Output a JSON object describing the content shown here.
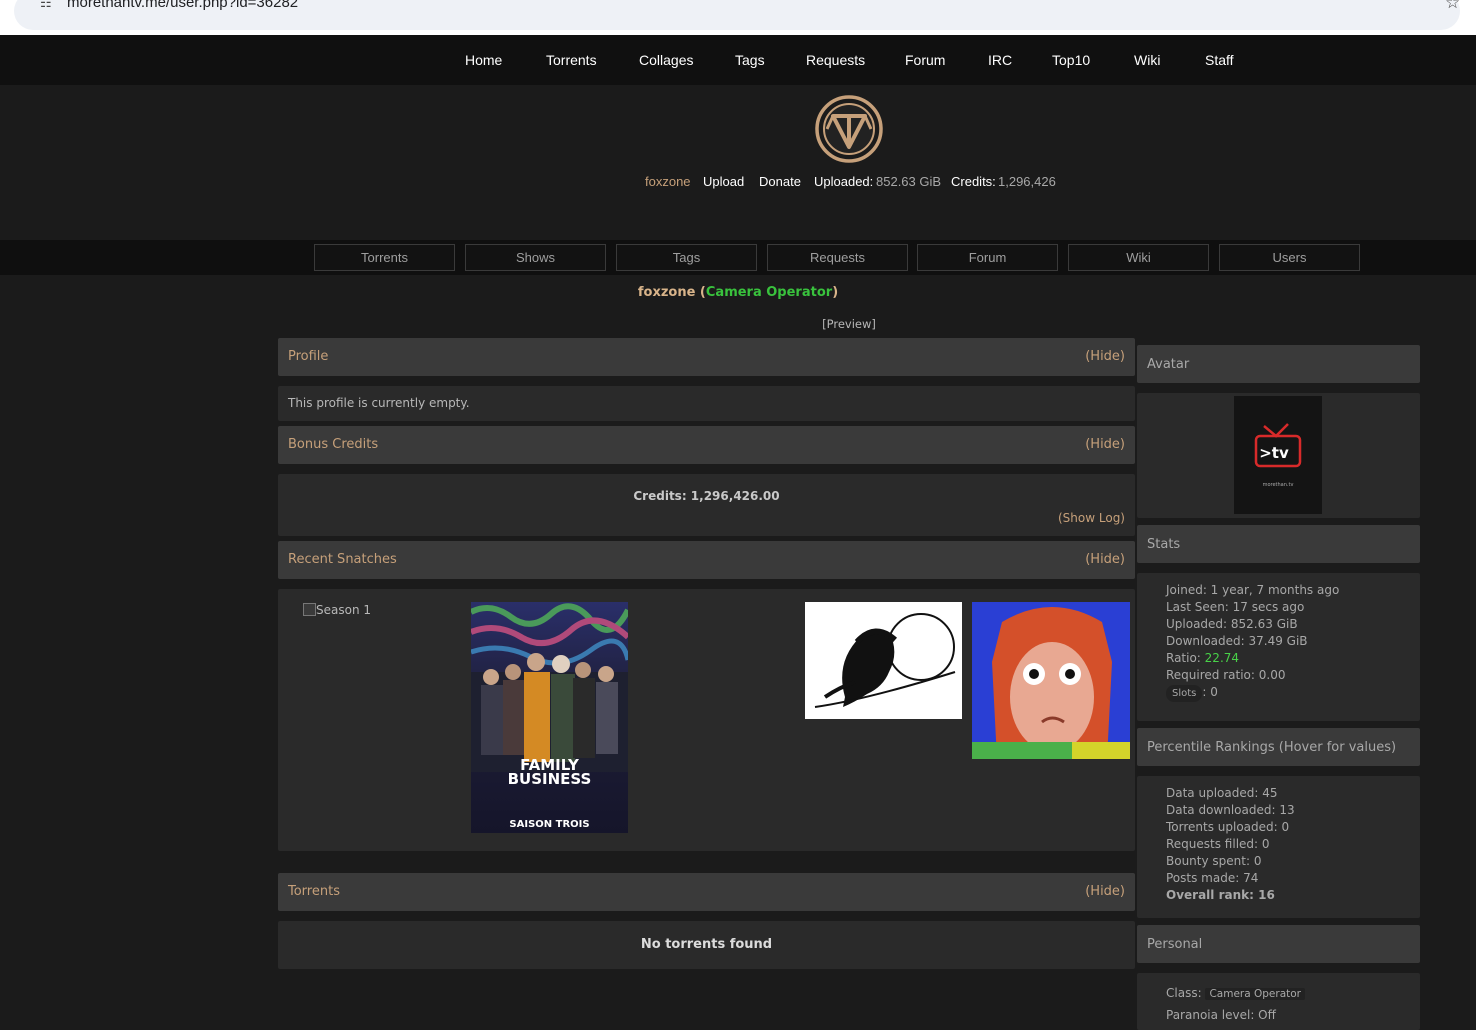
{
  "browser": {
    "url": "morethantv.me/user.php?id=36282",
    "tune_icon": "tune-icon",
    "bookmark_icon": "star-icon"
  },
  "topnav": [
    "Home",
    "Torrents",
    "Collages",
    "Tags",
    "Requests",
    "Forum",
    "IRC",
    "Top10",
    "Wiki",
    "Staff"
  ],
  "userbar": {
    "username": "foxzone",
    "upload": "Upload",
    "donate": "Donate",
    "uploaded_label": "Uploaded:",
    "uploaded_value": "852.63 GiB",
    "credits_label": "Credits:",
    "credits_value": "1,296,426"
  },
  "subnav": [
    "Torrents",
    "Shows",
    "Tags",
    "Requests",
    "Forum",
    "Wiki",
    "Users"
  ],
  "header": {
    "username": "foxzone",
    "open": " (",
    "class": "Camera Operator",
    "close": ")",
    "preview": "[Preview]"
  },
  "profile": {
    "title": "Profile",
    "hide": "(Hide)",
    "text": "This profile is currently empty."
  },
  "bonus": {
    "title": "Bonus Credits",
    "hide": "(Hide)",
    "credits": "Credits: 1,296,426.00",
    "show_log": "(Show Log)"
  },
  "snatches": {
    "title": "Recent Snatches",
    "hide": "(Hide)",
    "broken_alt": "Season 1",
    "poster_title_line1": "FAMILY",
    "poster_title_line2": "BUSINESS",
    "poster_subtitle": "SAISON TROIS"
  },
  "torrents": {
    "title": "Torrents",
    "hide": "(Hide)",
    "empty": "No torrents found"
  },
  "sidebar": {
    "avatar_title": "Avatar",
    "avatar_logo_text": ">tv",
    "avatar_small_text": "morethan.tv",
    "stats_title": "Stats",
    "joined": "Joined: 1 year, 7 months ago",
    "last_seen": "Last Seen: 17 secs ago",
    "uploaded": "Uploaded: 852.63 GiB",
    "downloaded": "Downloaded: 37.49 GiB",
    "ratio_label": "Ratio: ",
    "ratio_value": "22.74",
    "required_ratio": "Required ratio: 0.00",
    "slots_label": "Slots",
    "slots_value": ": 0",
    "percentile_title": "Percentile Rankings (Hover for values)",
    "data_uploaded": "Data uploaded: 45",
    "data_downloaded": "Data downloaded: 13",
    "torrents_uploaded": "Torrents uploaded: 0",
    "requests_filled": "Requests filled: 0",
    "bounty_spent": "Bounty spent: 0",
    "posts_made": "Posts made: 74",
    "overall_rank": "Overall rank: 16",
    "personal_title": "Personal",
    "class_label": "Class:",
    "class_value": "Camera Operator",
    "paranoia": "Paranoia level: Off"
  },
  "colors": {
    "gold": "#c6a07a",
    "green": "#39c23d",
    "panel_head": "#3a3a3a",
    "panel_body": "#2a2a2a"
  }
}
